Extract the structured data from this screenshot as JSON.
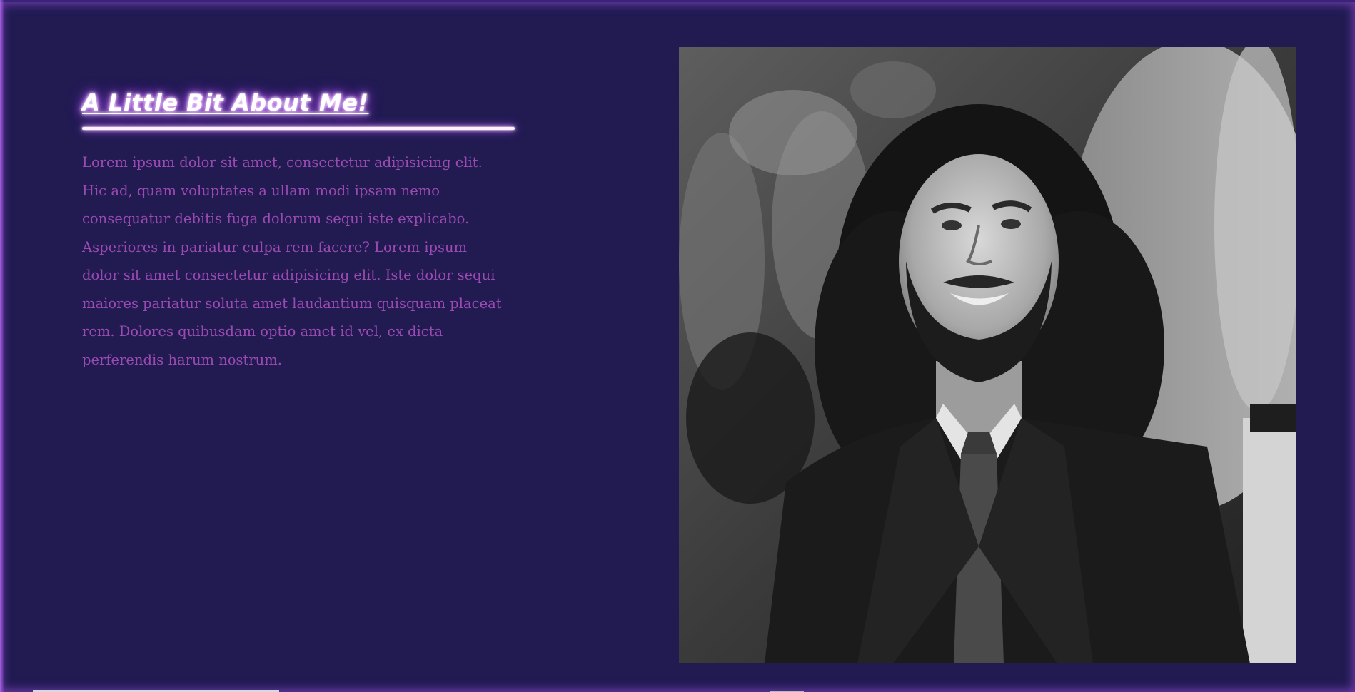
{
  "about": {
    "heading": "A Little Bit About Me!",
    "body": "Lorem ipsum dolor sit amet, consectetur adipisicing elit. Hic ad, quam voluptates a ullam modi ipsam nemo consequatur debitis fuga dolorum sequi iste explicabo. Asperiores in pariatur culpa rem facere? Lorem ipsum dolor sit amet consectetur adipisicing elit. Iste dolor sequi maiores pariatur soluta amet laudantium quisquam placeat rem. Dolores quibusdam optio amet id vel, ex dicta perferendis harum nostrum."
  },
  "colors": {
    "background": "#211b52",
    "heading_glow": "#c060ff",
    "body_text": "#9a4ab0",
    "frame_glow": "#a050e6"
  }
}
